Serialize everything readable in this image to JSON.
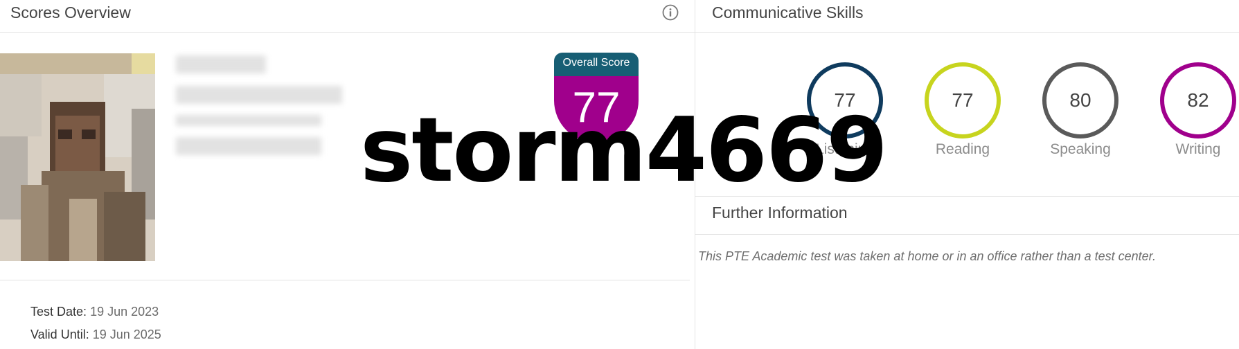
{
  "scores_overview": {
    "title": "Scores Overview",
    "info_icon": "info-icon",
    "overall_score_label": "Overall Score",
    "overall_score_value": "77",
    "test_date_label": "Test Date",
    "test_date_value": "19 Jun 2023",
    "valid_until_label": "Valid Until",
    "valid_until_value": "19 Jun 2025"
  },
  "communicative_skills": {
    "title": "Communicative Skills",
    "skills": [
      {
        "label": "Listening",
        "score": "77",
        "color": "#0f3b5e"
      },
      {
        "label": "Reading",
        "score": "77",
        "color": "#c7d41e"
      },
      {
        "label": "Speaking",
        "score": "80",
        "color": "#5a5a5a"
      },
      {
        "label": "Writing",
        "score": "82",
        "color": "#a0008c"
      }
    ]
  },
  "further_information": {
    "title": "Further Information",
    "text": "This PTE Academic test was taken at home or in an office rather than a test center."
  },
  "colors": {
    "overall_header": "#175e74",
    "overall_body": "#a0008c"
  },
  "watermark": "storm4669"
}
